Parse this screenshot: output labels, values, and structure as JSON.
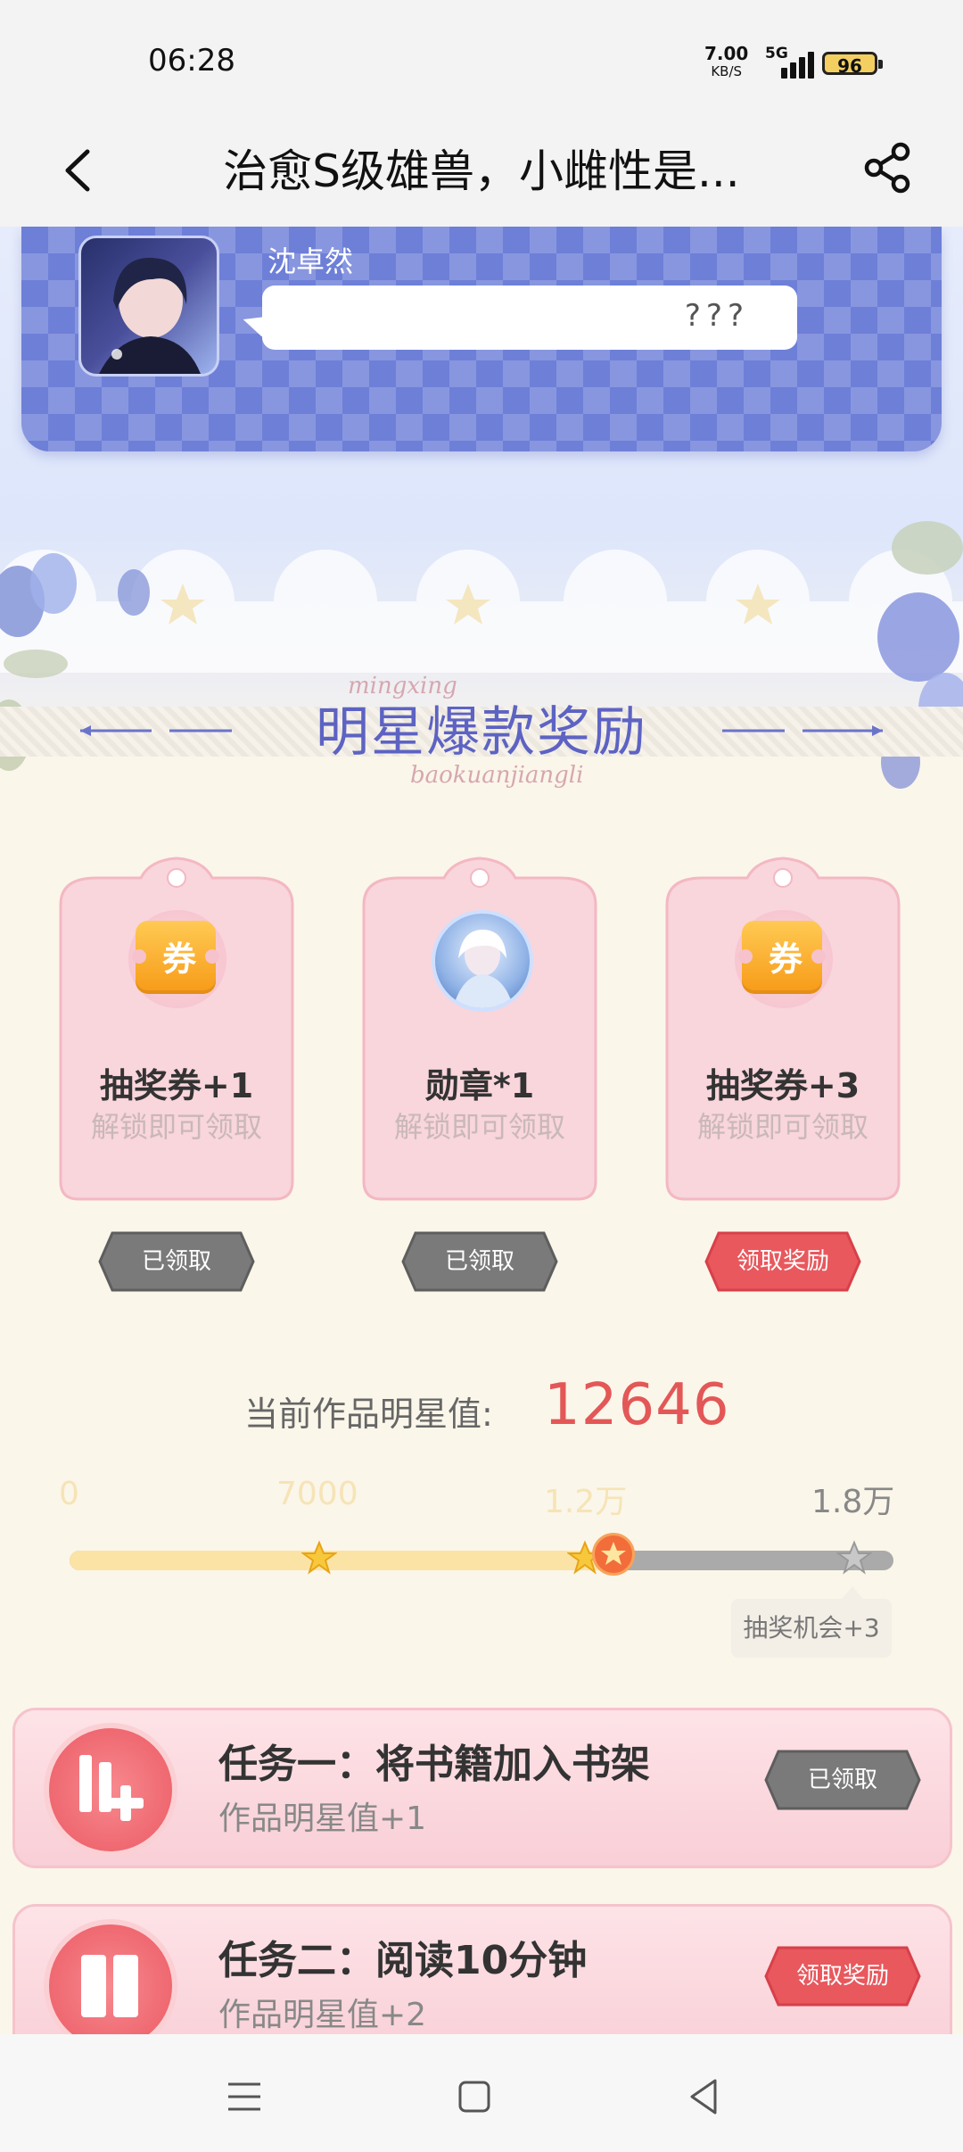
{
  "status_bar": {
    "time": "06:28",
    "net_speed": "7.00",
    "net_unit": "KB/S",
    "network": "5G",
    "battery": "96"
  },
  "header": {
    "title": "治愈S级雄兽，小雌性是...",
    "back_icon": "chevron-left-icon",
    "share_icon": "share-icon"
  },
  "chat": {
    "speaker": "沈卓然",
    "message": "???"
  },
  "banner": {
    "title": "明星爆款奖励",
    "script_top": "mingxing",
    "script_bottom": "baokuanjiangli"
  },
  "rewards": [
    {
      "name": "抽奖券+1",
      "sub": "解锁即可领取",
      "icon": "ticket-icon",
      "icon_text": "券",
      "button": "已领取",
      "state": "claimed"
    },
    {
      "name": "勋章*1",
      "sub": "解锁即可领取",
      "icon": "medal-icon",
      "icon_text": "",
      "button": "已领取",
      "state": "claimed"
    },
    {
      "name": "抽奖券+3",
      "sub": "解锁即可领取",
      "icon": "ticket-icon",
      "icon_text": "券",
      "button": "领取奖励",
      "state": "claimable"
    }
  ],
  "star_value": {
    "label": "当前作品明星值:",
    "value": "12646",
    "milestones": [
      "0",
      "7000",
      "1.2万",
      "1.8万"
    ],
    "progress_fraction": 0.66,
    "tooltip": "抽奖机会+3"
  },
  "tasks": [
    {
      "title": "任务一：将书籍加入书架",
      "sub": "作品明星值+1",
      "button": "已领取",
      "state": "claimed",
      "icon": "add-to-shelf-icon"
    },
    {
      "title": "任务二：阅读10分钟",
      "sub": "作品明星值+2",
      "button": "领取奖励",
      "state": "claimable",
      "icon": "book-icon"
    }
  ],
  "colors": {
    "accent_red": "#e35757",
    "claimed_gray": "#7a7a7a",
    "claim_red": "#e8585d",
    "chat_card": "#6e7fd8",
    "banner_title": "#5d63c3"
  }
}
